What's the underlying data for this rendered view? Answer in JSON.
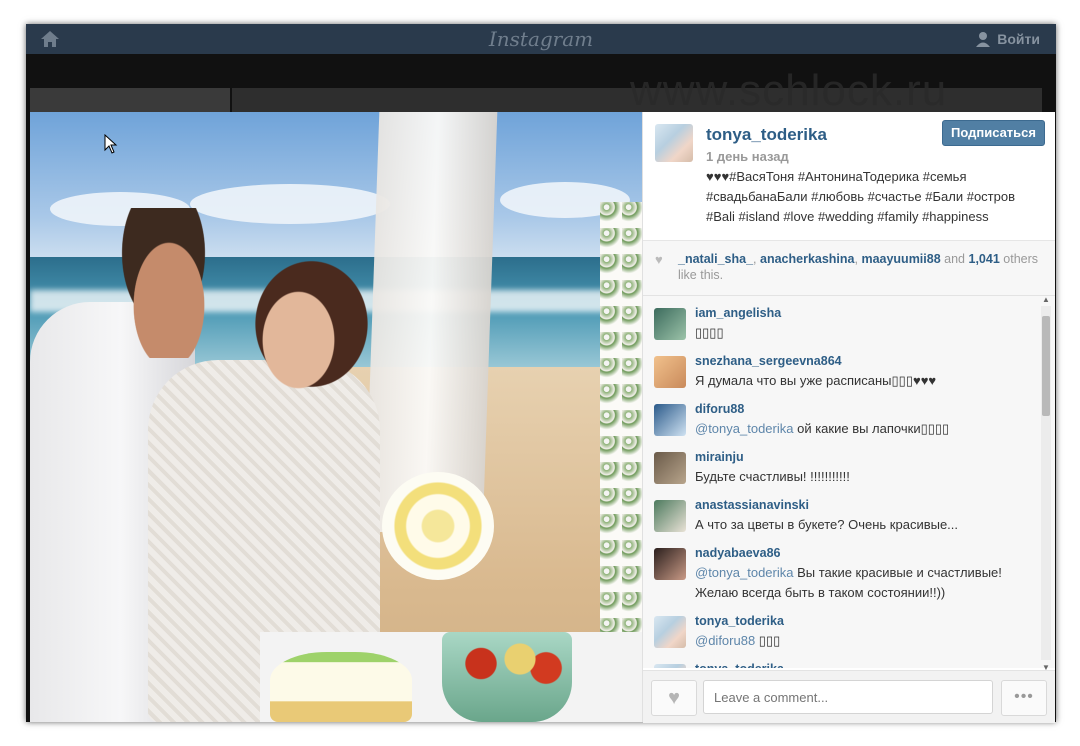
{
  "topbar": {
    "brand": "Instagram",
    "login": "Войти"
  },
  "watermark": "www.schlock.ru",
  "post": {
    "owner": "tonya_toderika",
    "follow_label": "Подписаться",
    "time": "1 день назад",
    "caption_lines": [
      "♥♥♥#ВасяТоня #АнтонинаТодерика #семья",
      "#свадьбанаБали #любовь #счастье #Бали #остров",
      "#Bali #island #love #wedding #family #happiness"
    ]
  },
  "likes": {
    "users": [
      "_natali_sha_",
      "anacherkashina",
      "maayuumii88"
    ],
    "and": "and",
    "count": "1,041",
    "others": "others like this."
  },
  "comments": [
    {
      "user": "iam_angelisha",
      "mention": "",
      "text": "▯▯▯▯"
    },
    {
      "user": "snezhana_sergeevna864",
      "mention": "",
      "text": "Я думала что вы уже расписаны▯▯▯♥♥♥"
    },
    {
      "user": "diforu88",
      "mention": "@tonya_toderika",
      "text": " ой какие вы лапочки▯▯▯▯"
    },
    {
      "user": "mirainju",
      "mention": "",
      "text": "Будьте счастливы! !!!!!!!!!!!"
    },
    {
      "user": "anastassianavinski",
      "mention": "",
      "text": "А что за цветы в букете? Очень красивые..."
    },
    {
      "user": "nadyabaeva86",
      "mention": "@tonya_toderika",
      "text": " Вы такие красивые и счастливые! Желаю всегда быть в таком состоянии!!))"
    },
    {
      "user": "tonya_toderika",
      "mention": "@diforu88",
      "text": " ▯▯▯"
    },
    {
      "user": "tonya_toderika",
      "mention": "",
      "text": ""
    }
  ],
  "footer": {
    "comment_placeholder": "Leave a comment...",
    "more_label": "•••",
    "like_icon": "heart-icon"
  },
  "colors": {
    "link": "#2e5e86",
    "follow_button": "#517fa4",
    "topbar": "#2a3a4c"
  }
}
